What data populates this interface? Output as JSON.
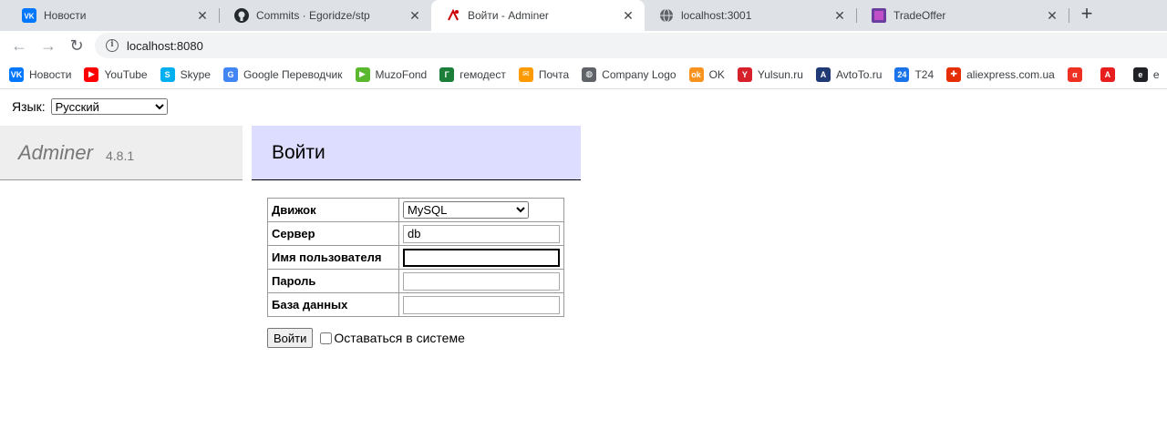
{
  "tabs": [
    {
      "title": "Новости",
      "icon": "vk-icon",
      "color": "#0077ff"
    },
    {
      "title": "Commits · Egoridze/stp",
      "icon": "github-icon",
      "color": "#24292e"
    },
    {
      "title": "Войти - Adminer",
      "icon": "adminer-icon",
      "color": "#cc0000"
    },
    {
      "title": "localhost:3001",
      "icon": "globe-icon",
      "color": "#5f6368"
    },
    {
      "title": "TradeOffer",
      "icon": "tradeoffer-icon",
      "color": "#6b3fa0"
    }
  ],
  "address": {
    "url": "localhost:8080"
  },
  "bookmarks": [
    {
      "label": "Новости",
      "icon": "vk-icon",
      "color": "#0077ff",
      "glyph": "VK"
    },
    {
      "label": "YouTube",
      "icon": "youtube-icon",
      "color": "#ff0000",
      "glyph": "▶"
    },
    {
      "label": "Skype",
      "icon": "skype-icon",
      "color": "#00aff0",
      "glyph": "S"
    },
    {
      "label": "Google Переводчик",
      "icon": "google-translate-icon",
      "color": "#4285f4",
      "glyph": "G"
    },
    {
      "label": "MuzoFond",
      "icon": "muzofond-icon",
      "color": "#5ab82e",
      "glyph": "▶"
    },
    {
      "label": "гемодест",
      "icon": "gemodest-icon",
      "color": "#1b7f3a",
      "glyph": "Г"
    },
    {
      "label": "Почта",
      "icon": "mail-icon",
      "color": "#ff9900",
      "glyph": "✉"
    },
    {
      "label": "Company Logo",
      "icon": "globe-icon",
      "color": "#5f6368",
      "glyph": "◍"
    },
    {
      "label": "OK",
      "icon": "ok-icon",
      "color": "#f7931e",
      "glyph": "ok"
    },
    {
      "label": "Yulsun.ru",
      "icon": "yulsun-icon",
      "color": "#d6212a",
      "glyph": "Y"
    },
    {
      "label": "AvtoTo.ru",
      "icon": "avtoto-icon",
      "color": "#1f3a75",
      "glyph": "A"
    },
    {
      "label": "T24",
      "icon": "t24-icon",
      "color": "#1a73e8",
      "glyph": "24"
    },
    {
      "label": "aliexpress.com.ua",
      "icon": "aliexpress-icon",
      "color": "#e62e04",
      "glyph": "✚"
    },
    {
      "label": "",
      "icon": "alfa-icon",
      "color": "#ef3124",
      "glyph": "α"
    },
    {
      "label": "",
      "icon": "adobe-icon",
      "color": "#e81d1d",
      "glyph": "A"
    },
    {
      "label": "e",
      "icon": "e-icon",
      "color": "#202124",
      "glyph": "e"
    }
  ],
  "language": {
    "label": "Язык:",
    "selected": "Русский"
  },
  "sidebar": {
    "app_name": "Adminer",
    "version": "4.8.1"
  },
  "page": {
    "title": "Войти"
  },
  "login_form": {
    "rows": [
      {
        "label": "Движок",
        "type": "select",
        "value": "MySQL"
      },
      {
        "label": "Сервер",
        "type": "text",
        "value": "db"
      },
      {
        "label": "Имя пользователя",
        "type": "text",
        "value": ""
      },
      {
        "label": "Пароль",
        "type": "password",
        "value": ""
      },
      {
        "label": "База данных",
        "type": "text",
        "value": ""
      }
    ],
    "submit_label": "Войти",
    "remember_label": "Оставаться в системе"
  }
}
